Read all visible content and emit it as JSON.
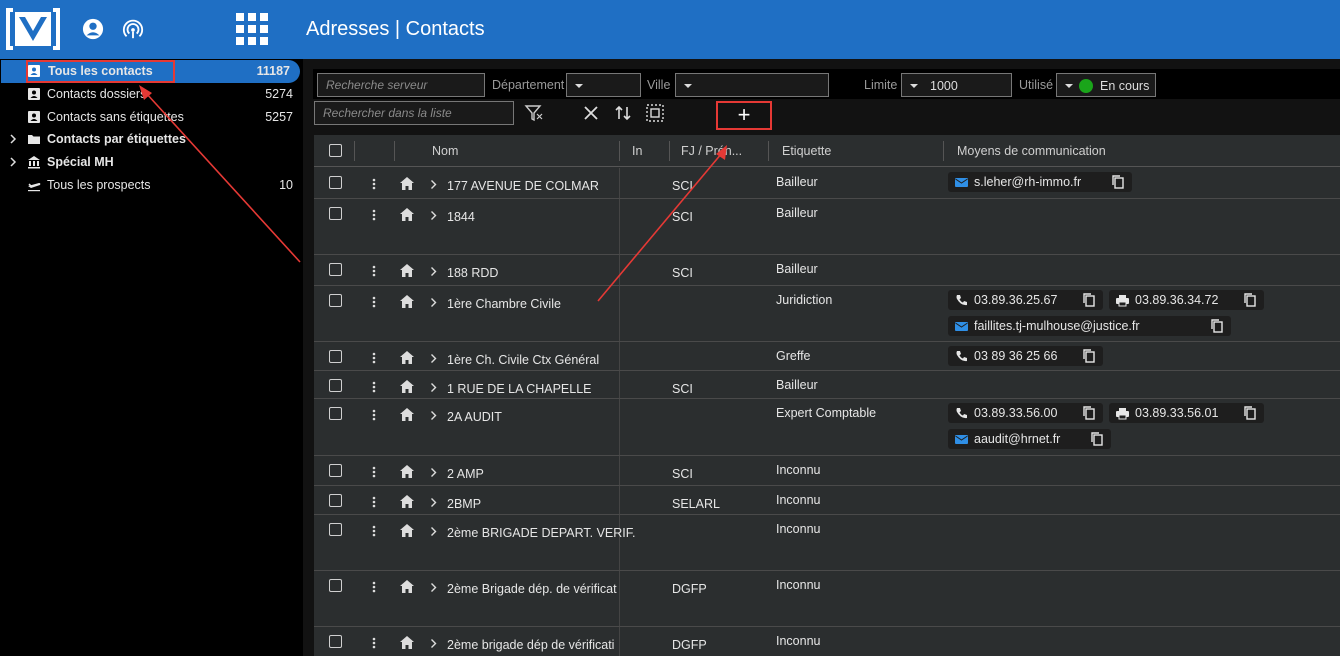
{
  "header": {
    "title": "Adresses | Contacts"
  },
  "sidebar": {
    "items": [
      {
        "label": "Tous les contacts",
        "count": "11187"
      },
      {
        "label": "Contacts dossiers",
        "count": "5274"
      },
      {
        "label": "Contacts sans étiquettes",
        "count": "5257"
      },
      {
        "label": "Contacts par étiquettes",
        "count": ""
      },
      {
        "label": "Spécial MH",
        "count": ""
      },
      {
        "label": "Tous les prospects",
        "count": "10"
      }
    ]
  },
  "filters": {
    "server_search_placeholder": "Recherche serveur",
    "departement_label": "Département",
    "ville_label": "Ville",
    "limite_label": "Limite",
    "limite_value": "1000",
    "utilise_label": "Utilisé",
    "utilise_value": "En cours",
    "list_search_placeholder": "Rechercher dans la liste",
    "add_label": "+"
  },
  "table": {
    "columns": [
      "Nom",
      "In",
      "FJ / Prén...",
      "Etiquette",
      "Moyens de communication"
    ],
    "rows": [
      {
        "nom": "177 AVENUE DE COLMAR",
        "fj": "SCI",
        "etiquette": "Bailleur",
        "contacts": [
          {
            "type": "mail",
            "value": "s.leher@rh-immo.fr"
          }
        ]
      },
      {
        "nom": "1844",
        "fj": "SCI",
        "etiquette": "Bailleur",
        "contacts": []
      },
      {
        "nom": "188 RDD",
        "fj": "SCI",
        "etiquette": "Bailleur",
        "contacts": []
      },
      {
        "nom": "1ère Chambre Civile",
        "fj": "",
        "etiquette": "Juridiction",
        "contacts": [
          {
            "type": "phone",
            "value": "03.89.36.25.67"
          },
          {
            "type": "fax",
            "value": "03.89.36.34.72"
          },
          {
            "type": "mail",
            "value": "faillites.tj-mulhouse@justice.fr"
          }
        ]
      },
      {
        "nom": "1ère Ch. Civile Ctx Général",
        "fj": "",
        "etiquette": "Greffe",
        "contacts": [
          {
            "type": "phone",
            "value": "03 89 36 25 66"
          }
        ]
      },
      {
        "nom": "1 RUE DE LA CHAPELLE",
        "fj": "SCI",
        "etiquette": "Bailleur",
        "contacts": []
      },
      {
        "nom": "2A AUDIT",
        "fj": "",
        "etiquette": "Expert Comptable",
        "contacts": [
          {
            "type": "phone",
            "value": "03.89.33.56.00"
          },
          {
            "type": "fax",
            "value": "03.89.33.56.01"
          },
          {
            "type": "mail",
            "value": "aaudit@hrnet.fr"
          }
        ]
      },
      {
        "nom": "2 AMP",
        "fj": "SCI",
        "etiquette": "Inconnu",
        "contacts": []
      },
      {
        "nom": "2BMP",
        "fj": "SELARL",
        "etiquette": "Inconnu",
        "contacts": []
      },
      {
        "nom": "2ème BRIGADE DEPART. VERIF.",
        "fj": "",
        "etiquette": "Inconnu",
        "contacts": []
      },
      {
        "nom": "2ème Brigade dép. de vérificat",
        "fj": "DGFP",
        "etiquette": "Inconnu",
        "contacts": []
      },
      {
        "nom": "2ème brigade dép de vérificati",
        "fj": "DGFP",
        "etiquette": "Inconnu",
        "contacts": []
      }
    ]
  },
  "colors": {
    "brand": "#1f6fc4",
    "mail_icon": "#2f8fe6",
    "status_green": "#1aa51a",
    "annotation": "#e53935"
  },
  "icons": [
    "logo-icon",
    "account-icon",
    "broadcast-icon",
    "apps-grid-icon",
    "contact-card-icon",
    "folder-icon",
    "bank-icon",
    "plane-icon",
    "filter-icon",
    "close-icon",
    "sort-icon",
    "select-all-icon",
    "plus-icon",
    "more-vert-icon",
    "home-icon",
    "chevron-right-icon",
    "mail-icon",
    "phone-icon",
    "fax-icon",
    "copy-icon"
  ]
}
